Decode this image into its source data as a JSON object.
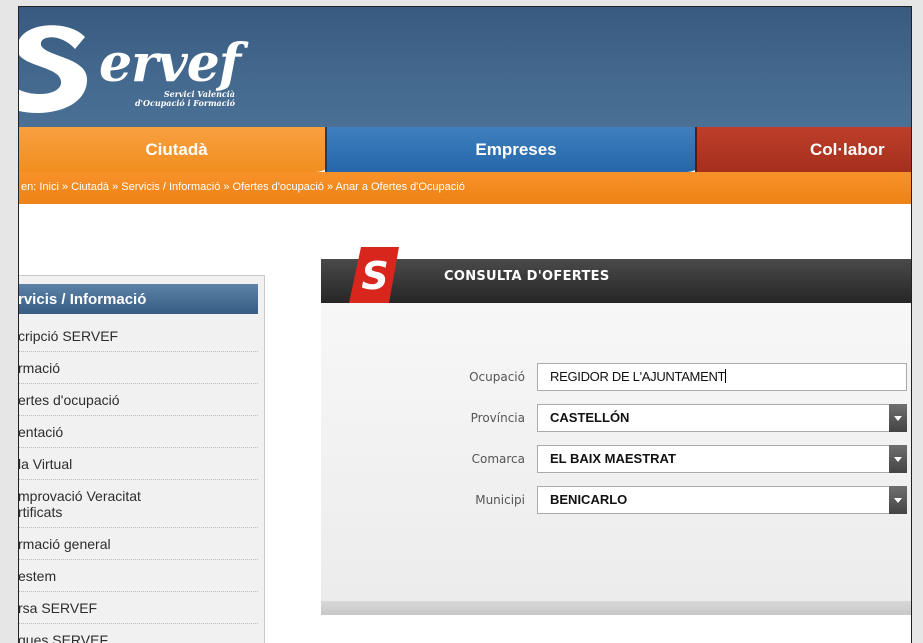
{
  "logo": {
    "word": "ervef",
    "subtitle_line1": "Servici Valencià",
    "subtitle_line2": "d'Ocupació i Formació"
  },
  "tabs": [
    {
      "label": "Ciutadà"
    },
    {
      "label": "Empreses"
    },
    {
      "label": "Col·labor"
    }
  ],
  "breadcrumb": "en: Inici » Ciutadà » Servicis / Informació » Ofertes d'ocupació » Anar a Ofertes d'Ocupació",
  "sidebar": {
    "title": "rvicis / Informació",
    "items": [
      {
        "label": "cripció SERVEF"
      },
      {
        "label": "rmació"
      },
      {
        "label": "ertes d'ocupació"
      },
      {
        "label": "entació"
      },
      {
        "label": "la Virtual"
      },
      {
        "label": "mprovació Veracitat",
        "label2": "rtificats"
      },
      {
        "label": "rmació general"
      },
      {
        "label": "estem"
      },
      {
        "label": "rsa SERVEF"
      },
      {
        "label": "ques SERVEF"
      }
    ]
  },
  "panel": {
    "logo_letter": "S",
    "title": "CONSULTA D'OFERTES",
    "fields": {
      "ocupacio": {
        "label": "Ocupació",
        "value": "REGIDOR DE L'AJUNTAMENT"
      },
      "provincia": {
        "label": "Província",
        "value": "CASTELLÓN"
      },
      "comarca": {
        "label": "Comarca",
        "value": "EL BAIX MAESTRAT"
      },
      "municipi": {
        "label": "Municipi",
        "value": "BENICARLO"
      }
    }
  },
  "colors": {
    "header_blue": "#44698f",
    "tab_orange": "#f18e1f",
    "tab_blue": "#2467a8",
    "tab_red": "#a42f1c",
    "logo_red": "#d9261c"
  }
}
